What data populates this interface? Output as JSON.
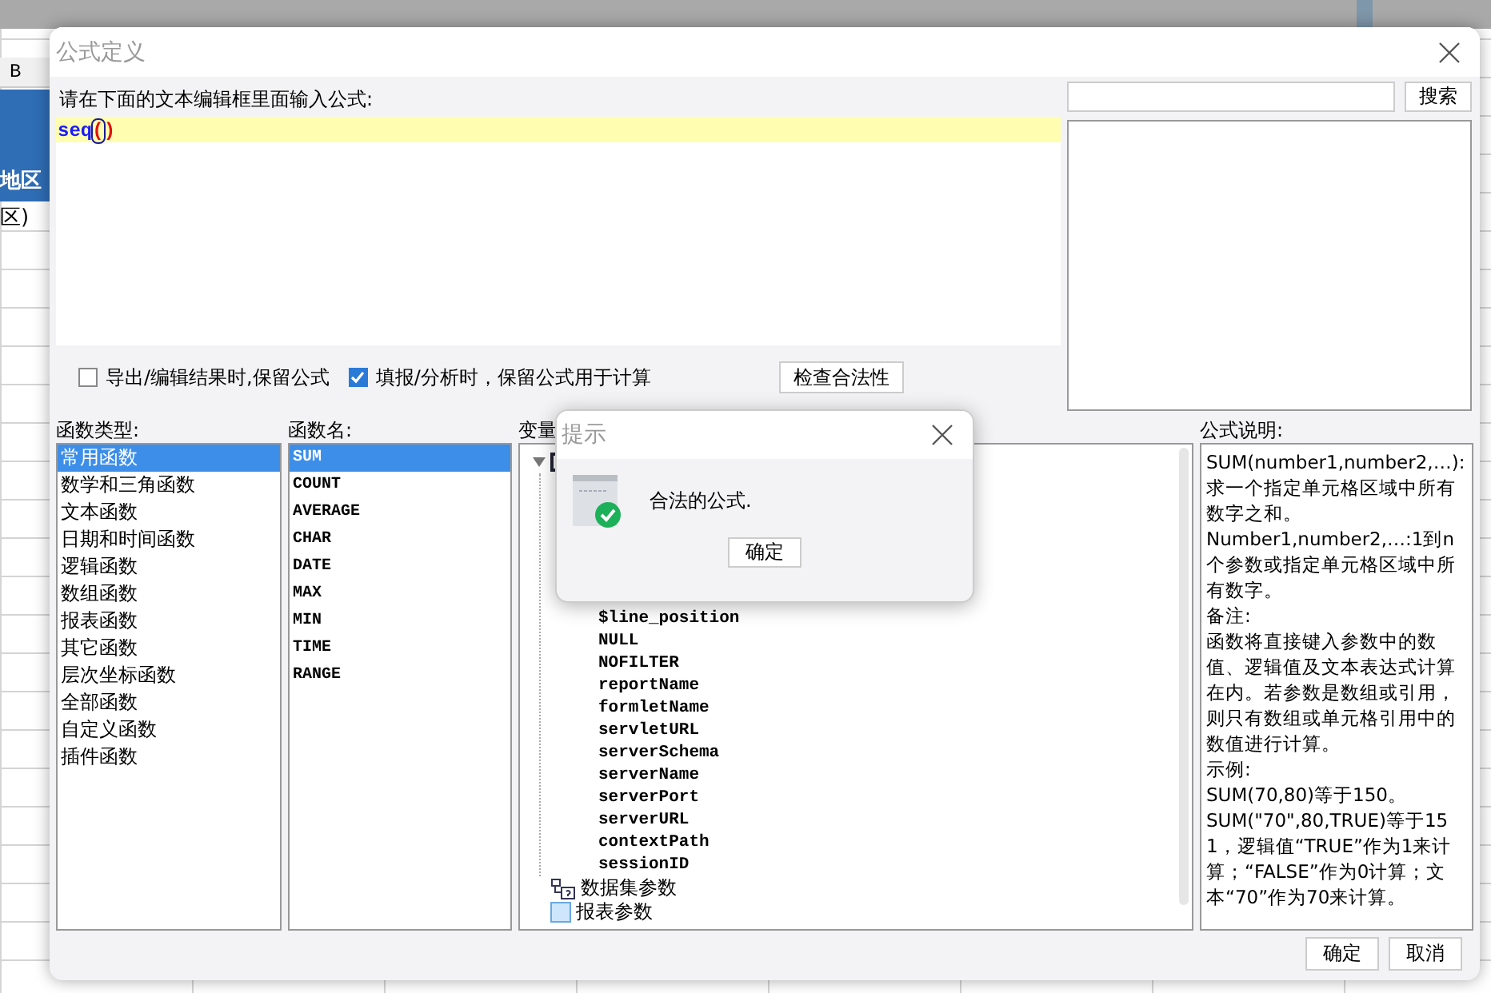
{
  "background_sheet": {
    "column_header": "B",
    "header_cell": "地区",
    "cell": "区)"
  },
  "dialog": {
    "title": "公式定义"
  },
  "editor": {
    "label": "请在下面的文本编辑框里面输入公式:",
    "formula": [
      {
        "text": "seq",
        "kind": "function",
        "cursor": false
      },
      {
        "text": "(",
        "kind": "paren",
        "cursor": true
      },
      {
        "text": ")",
        "kind": "paren",
        "cursor": false
      }
    ]
  },
  "search": {
    "button": "搜索"
  },
  "options": [
    {
      "label": "导出/编辑结果时,保留公式",
      "checked": false
    },
    {
      "label": "填报/分析时，保留公式用于计算",
      "checked": true
    }
  ],
  "check_button": "检查合法性",
  "function_types": {
    "title": "函数类型:",
    "items": [
      {
        "label": "常用函数",
        "selected": true
      },
      {
        "label": "数学和三角函数",
        "selected": false
      },
      {
        "label": "文本函数",
        "selected": false
      },
      {
        "label": "日期和时间函数",
        "selected": false
      },
      {
        "label": "逻辑函数",
        "selected": false
      },
      {
        "label": "数组函数",
        "selected": false
      },
      {
        "label": "报表函数",
        "selected": false
      },
      {
        "label": "其它函数",
        "selected": false
      },
      {
        "label": "层次坐标函数",
        "selected": false
      },
      {
        "label": "全部函数",
        "selected": false
      },
      {
        "label": "自定义函数",
        "selected": false
      },
      {
        "label": "插件函数",
        "selected": false
      }
    ]
  },
  "function_names": {
    "title": "函数名:",
    "items": [
      {
        "label": "SUM",
        "selected": true
      },
      {
        "label": "COUNT",
        "selected": false
      },
      {
        "label": "AVERAGE",
        "selected": false
      },
      {
        "label": "CHAR",
        "selected": false
      },
      {
        "label": "DATE",
        "selected": false
      },
      {
        "label": "MAX",
        "selected": false
      },
      {
        "label": "MIN",
        "selected": false
      },
      {
        "label": "TIME",
        "selected": false
      },
      {
        "label": "RANGE",
        "selected": false
      }
    ]
  },
  "variables": {
    "title": "变量",
    "items": [
      {
        "kind": "group",
        "expanded": true,
        "children": [
          {
            "label": "$line_position"
          },
          {
            "label": "NULL"
          },
          {
            "label": "NOFILTER"
          },
          {
            "label": "reportName"
          },
          {
            "label": "formletName"
          },
          {
            "label": "servletURL"
          },
          {
            "label": "serverSchema"
          },
          {
            "label": "serverName"
          },
          {
            "label": "serverPort"
          },
          {
            "label": "serverURL"
          },
          {
            "label": "contextPath"
          },
          {
            "label": "sessionID"
          }
        ]
      },
      {
        "kind": "dataset",
        "label": "数据集参数"
      },
      {
        "kind": "param",
        "label": "报表参数"
      }
    ]
  },
  "description": {
    "title": "公式说明:",
    "paragraphs": [
      "SUM(number1,number2,…):求一个指定单元格区域中所有数字之和。",
      "Number1,number2,…:1到n个参数或指定单元格区域中所有数字。",
      "备注:",
      "函数将直接键入参数中的数值、逻辑值及文本表达式计算在内。若参数是数组或引用，则只有数组或单元格引用中的数值进行计算。",
      "示例:",
      "SUM(70,80)等于150。",
      "SUM(\"70\",80,TRUE)等于151，逻辑值“TRUE”作为1来计算；“FALSE”作为0计算；文本“70”作为70来计算。"
    ]
  },
  "buttons": [
    "确定",
    "取消"
  ],
  "alert": {
    "title": "提示",
    "message": "合法的公式.",
    "button": "确定"
  }
}
